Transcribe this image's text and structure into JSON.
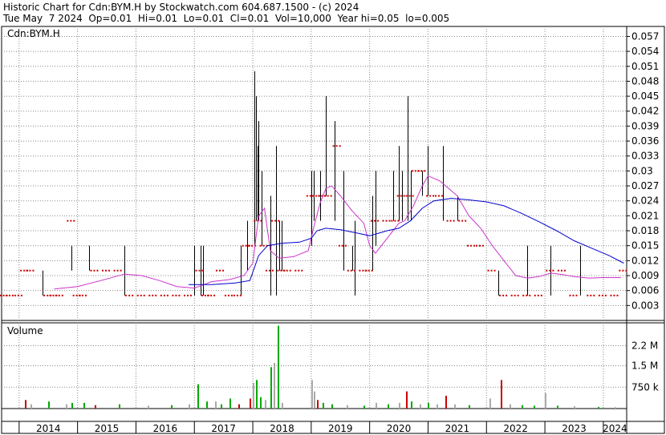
{
  "header": {
    "line1": "Historic Chart for Cdn:BYM.H by Stockwatch.com 604.687.1500 - (c) 2024",
    "line2": "Tue May  7 2024  Op=0.01  Hi=0.01  Lo=0.01  Cl=0.01  Vol=10,000  Year hi=0.05  lo=0.005"
  },
  "price_panel": {
    "label": "Cdn:BYM.H"
  },
  "volume_panel": {
    "label": "Volume"
  },
  "colors": {
    "price_bar": "#000000",
    "close_dot": "#cc0000",
    "ma_short": "#cc33cc",
    "ma_long": "#0000cc",
    "vol_up": "#00aa00",
    "vol_down": "#cc0000",
    "vol_flat": "#aaaaaa",
    "grid": "#888888"
  },
  "chart_data": [
    {
      "type": "line",
      "title": "Cdn:BYM.H",
      "x_ticks": [
        "2014",
        "2015",
        "2016",
        "2017",
        "2018",
        "2019",
        "2020",
        "2021",
        "2022",
        "2023",
        "2024"
      ],
      "ylim": [
        0,
        0.059
      ],
      "y_ticks": [
        "0.057",
        "0.054",
        "0.051",
        "0.048",
        "0.045",
        "0.042",
        "0.039",
        "0.036",
        "0.033",
        "0.03",
        "0.027",
        "0.024",
        "0.021",
        "0.018",
        "0.015",
        "0.012",
        "0.009",
        "0.006",
        "0.003"
      ],
      "xlim": [
        2013.7,
        2024.4
      ],
      "bars": [
        [
          2014.4,
          0.005,
          0.01
        ],
        [
          2014.9,
          0.01,
          0.015
        ],
        [
          2015.2,
          0.01,
          0.015
        ],
        [
          2015.8,
          0.005,
          0.015
        ],
        [
          2017.0,
          0.005,
          0.015
        ],
        [
          2017.1,
          0.005,
          0.015
        ],
        [
          2017.15,
          0.005,
          0.015
        ],
        [
          2017.8,
          0.005,
          0.015
        ],
        [
          2017.9,
          0.01,
          0.02
        ],
        [
          2018.02,
          0.015,
          0.05
        ],
        [
          2018.05,
          0.02,
          0.045
        ],
        [
          2018.08,
          0.02,
          0.035
        ],
        [
          2018.1,
          0.02,
          0.04
        ],
        [
          2018.15,
          0.015,
          0.03
        ],
        [
          2018.3,
          0.005,
          0.025
        ],
        [
          2018.4,
          0.005,
          0.035
        ],
        [
          2018.45,
          0.01,
          0.02
        ],
        [
          2018.5,
          0.01,
          0.02
        ],
        [
          2019.0,
          0.015,
          0.03
        ],
        [
          2019.05,
          0.02,
          0.03
        ],
        [
          2019.15,
          0.02,
          0.03
        ],
        [
          2019.25,
          0.025,
          0.045
        ],
        [
          2019.4,
          0.02,
          0.04
        ],
        [
          2019.55,
          0.01,
          0.03
        ],
        [
          2019.7,
          0.01,
          0.015
        ],
        [
          2019.75,
          0.005,
          0.02
        ],
        [
          2020.05,
          0.01,
          0.025
        ],
        [
          2020.1,
          0.015,
          0.03
        ],
        [
          2020.4,
          0.02,
          0.03
        ],
        [
          2020.5,
          0.02,
          0.035
        ],
        [
          2020.55,
          0.02,
          0.03
        ],
        [
          2020.65,
          0.02,
          0.045
        ],
        [
          2020.7,
          0.02,
          0.03
        ],
        [
          2020.9,
          0.025,
          0.03
        ],
        [
          2021.0,
          0.025,
          0.035
        ],
        [
          2021.25,
          0.02,
          0.035
        ],
        [
          2021.5,
          0.02,
          0.025
        ],
        [
          2022.2,
          0.005,
          0.01
        ],
        [
          2022.7,
          0.005,
          0.015
        ],
        [
          2023.1,
          0.005,
          0.015
        ],
        [
          2023.6,
          0.005,
          0.015
        ]
      ],
      "closes": [
        [
          2013.75,
          0.005
        ],
        [
          2013.85,
          0.005
        ],
        [
          2014.0,
          0.005
        ],
        [
          2014.1,
          0.01
        ],
        [
          2014.2,
          0.01
        ],
        [
          2014.5,
          0.005
        ],
        [
          2014.6,
          0.005
        ],
        [
          2014.7,
          0.005
        ],
        [
          2014.9,
          0.02
        ],
        [
          2015.0,
          0.005
        ],
        [
          2015.1,
          0.005
        ],
        [
          2015.3,
          0.01
        ],
        [
          2015.5,
          0.01
        ],
        [
          2015.7,
          0.01
        ],
        [
          2015.9,
          0.005
        ],
        [
          2016.1,
          0.005
        ],
        [
          2016.3,
          0.005
        ],
        [
          2016.5,
          0.005
        ],
        [
          2016.7,
          0.005
        ],
        [
          2016.9,
          0.005
        ],
        [
          2017.1,
          0.01
        ],
        [
          2017.2,
          0.005
        ],
        [
          2017.3,
          0.005
        ],
        [
          2017.45,
          0.01
        ],
        [
          2017.6,
          0.005
        ],
        [
          2017.75,
          0.005
        ],
        [
          2017.9,
          0.015
        ],
        [
          2018.0,
          0.015
        ],
        [
          2018.1,
          0.02
        ],
        [
          2018.2,
          0.015
        ],
        [
          2018.3,
          0.01
        ],
        [
          2018.4,
          0.02
        ],
        [
          2018.5,
          0.01
        ],
        [
          2018.6,
          0.01
        ],
        [
          2018.8,
          0.01
        ],
        [
          2019.0,
          0.025
        ],
        [
          2019.1,
          0.025
        ],
        [
          2019.2,
          0.025
        ],
        [
          2019.3,
          0.025
        ],
        [
          2019.45,
          0.035
        ],
        [
          2019.55,
          0.015
        ],
        [
          2019.7,
          0.01
        ],
        [
          2019.9,
          0.01
        ],
        [
          2020.0,
          0.01
        ],
        [
          2020.1,
          0.02
        ],
        [
          2020.3,
          0.02
        ],
        [
          2020.45,
          0.02
        ],
        [
          2020.55,
          0.025
        ],
        [
          2020.7,
          0.025
        ],
        [
          2020.8,
          0.03
        ],
        [
          2020.9,
          0.03
        ],
        [
          2021.05,
          0.025
        ],
        [
          2021.2,
          0.025
        ],
        [
          2021.4,
          0.02
        ],
        [
          2021.6,
          0.02
        ],
        [
          2021.75,
          0.015
        ],
        [
          2021.9,
          0.015
        ],
        [
          2022.1,
          0.01
        ],
        [
          2022.3,
          0.005
        ],
        [
          2022.5,
          0.005
        ],
        [
          2022.7,
          0.005
        ],
        [
          2022.9,
          0.005
        ],
        [
          2023.1,
          0.01
        ],
        [
          2023.3,
          0.01
        ],
        [
          2023.5,
          0.005
        ],
        [
          2023.8,
          0.005
        ],
        [
          2024.0,
          0.005
        ],
        [
          2024.2,
          0.005
        ],
        [
          2024.35,
          0.01
        ]
      ],
      "series": [
        {
          "values": [
            [
              2014.6,
              0.0063
            ],
            [
              2015.0,
              0.0068
            ],
            [
              2015.4,
              0.008
            ],
            [
              2015.8,
              0.0093
            ],
            [
              2016.1,
              0.009
            ],
            [
              2016.4,
              0.008
            ],
            [
              2016.7,
              0.0068
            ],
            [
              2017.0,
              0.0065
            ],
            [
              2017.3,
              0.0078
            ],
            [
              2017.6,
              0.0082
            ],
            [
              2017.85,
              0.009
            ],
            [
              2018.0,
              0.0115
            ],
            [
              2018.1,
              0.021
            ],
            [
              2018.2,
              0.0225
            ],
            [
              2018.3,
              0.014
            ],
            [
              2018.45,
              0.0125
            ],
            [
              2018.7,
              0.0128
            ],
            [
              2018.95,
              0.014
            ],
            [
              2019.05,
              0.019
            ],
            [
              2019.15,
              0.0235
            ],
            [
              2019.25,
              0.0265
            ],
            [
              2019.35,
              0.027
            ],
            [
              2019.5,
              0.025
            ],
            [
              2019.7,
              0.022
            ],
            [
              2019.9,
              0.0195
            ],
            [
              2020.0,
              0.015
            ],
            [
              2020.1,
              0.0135
            ],
            [
              2020.3,
              0.0165
            ],
            [
              2020.5,
              0.0195
            ],
            [
              2020.6,
              0.02
            ],
            [
              2020.75,
              0.023
            ],
            [
              2020.9,
              0.027
            ],
            [
              2021.0,
              0.029
            ],
            [
              2021.2,
              0.028
            ],
            [
              2021.5,
              0.025
            ],
            [
              2021.7,
              0.021
            ],
            [
              2021.9,
              0.0185
            ],
            [
              2022.1,
              0.015
            ],
            [
              2022.3,
              0.012
            ],
            [
              2022.5,
              0.009
            ],
            [
              2022.7,
              0.0085
            ],
            [
              2022.9,
              0.0088
            ],
            [
              2023.1,
              0.0095
            ],
            [
              2023.3,
              0.0092
            ],
            [
              2023.5,
              0.0088
            ],
            [
              2023.75,
              0.0085
            ],
            [
              2024.0,
              0.0086
            ],
            [
              2024.3,
              0.0086
            ]
          ]
        },
        {
          "values": [
            [
              2016.9,
              0.0072
            ],
            [
              2017.3,
              0.0072
            ],
            [
              2017.7,
              0.0075
            ],
            [
              2017.95,
              0.008
            ],
            [
              2018.1,
              0.013
            ],
            [
              2018.25,
              0.015
            ],
            [
              2018.5,
              0.0155
            ],
            [
              2018.8,
              0.0157
            ],
            [
              2019.0,
              0.0165
            ],
            [
              2019.1,
              0.018
            ],
            [
              2019.25,
              0.0185
            ],
            [
              2019.5,
              0.0182
            ],
            [
              2019.8,
              0.0175
            ],
            [
              2020.0,
              0.017
            ],
            [
              2020.3,
              0.018
            ],
            [
              2020.5,
              0.0185
            ],
            [
              2020.7,
              0.02
            ],
            [
              2020.9,
              0.0225
            ],
            [
              2021.1,
              0.024
            ],
            [
              2021.4,
              0.0245
            ],
            [
              2021.7,
              0.0242
            ],
            [
              2022.0,
              0.0238
            ],
            [
              2022.3,
              0.023
            ],
            [
              2022.6,
              0.0215
            ],
            [
              2022.9,
              0.0198
            ],
            [
              2023.2,
              0.018
            ],
            [
              2023.5,
              0.016
            ],
            [
              2023.8,
              0.0145
            ],
            [
              2024.1,
              0.013
            ],
            [
              2024.35,
              0.0115
            ]
          ]
        }
      ]
    },
    {
      "type": "bar",
      "title": "Volume",
      "y_ticks": [
        "2.2 M",
        "1.5 M",
        "750 k"
      ],
      "ylim": [
        0,
        3000000
      ],
      "volumes": [
        [
          2014.1,
          300000,
          "down"
        ],
        [
          2014.2,
          150000,
          "flat"
        ],
        [
          2014.5,
          250000,
          "up"
        ],
        [
          2014.8,
          150000,
          "flat"
        ],
        [
          2014.9,
          200000,
          "up"
        ],
        [
          2015.1,
          200000,
          "up"
        ],
        [
          2015.3,
          120000,
          "down"
        ],
        [
          2015.7,
          150000,
          "up"
        ],
        [
          2016.2,
          100000,
          "flat"
        ],
        [
          2016.6,
          120000,
          "up"
        ],
        [
          2016.9,
          150000,
          "flat"
        ],
        [
          2017.05,
          850000,
          "up"
        ],
        [
          2017.2,
          250000,
          "up"
        ],
        [
          2017.35,
          250000,
          "flat"
        ],
        [
          2017.45,
          150000,
          "up"
        ],
        [
          2017.6,
          350000,
          "up"
        ],
        [
          2017.75,
          150000,
          "down"
        ],
        [
          2017.95,
          350000,
          "down"
        ],
        [
          2018.0,
          900000,
          "flat"
        ],
        [
          2018.05,
          1000000,
          "up"
        ],
        [
          2018.12,
          400000,
          "up"
        ],
        [
          2018.2,
          300000,
          "flat"
        ],
        [
          2018.3,
          1450000,
          "up"
        ],
        [
          2018.35,
          1600000,
          "flat"
        ],
        [
          2018.42,
          2900000,
          "up"
        ],
        [
          2018.5,
          200000,
          "flat"
        ],
        [
          2019.0,
          1000000,
          "flat"
        ],
        [
          2019.05,
          600000,
          "flat"
        ],
        [
          2019.1,
          300000,
          "down"
        ],
        [
          2019.2,
          200000,
          "up"
        ],
        [
          2019.35,
          150000,
          "up"
        ],
        [
          2019.6,
          120000,
          "flat"
        ],
        [
          2019.9,
          100000,
          "up"
        ],
        [
          2020.1,
          200000,
          "flat"
        ],
        [
          2020.3,
          150000,
          "up"
        ],
        [
          2020.5,
          200000,
          "flat"
        ],
        [
          2020.62,
          600000,
          "down"
        ],
        [
          2020.7,
          250000,
          "up"
        ],
        [
          2020.85,
          150000,
          "flat"
        ],
        [
          2021.0,
          200000,
          "up"
        ],
        [
          2021.15,
          150000,
          "flat"
        ],
        [
          2021.3,
          450000,
          "down"
        ],
        [
          2021.45,
          150000,
          "flat"
        ],
        [
          2021.7,
          120000,
          "up"
        ],
        [
          2022.05,
          350000,
          "flat"
        ],
        [
          2022.25,
          1000000,
          "down"
        ],
        [
          2022.4,
          150000,
          "flat"
        ],
        [
          2022.6,
          120000,
          "up"
        ],
        [
          2022.8,
          100000,
          "up"
        ],
        [
          2023.0,
          550000,
          "flat"
        ],
        [
          2023.2,
          100000,
          "up"
        ],
        [
          2023.5,
          80000,
          "flat"
        ],
        [
          2023.9,
          60000,
          "up"
        ],
        [
          2024.2,
          50000,
          "flat"
        ]
      ]
    }
  ]
}
